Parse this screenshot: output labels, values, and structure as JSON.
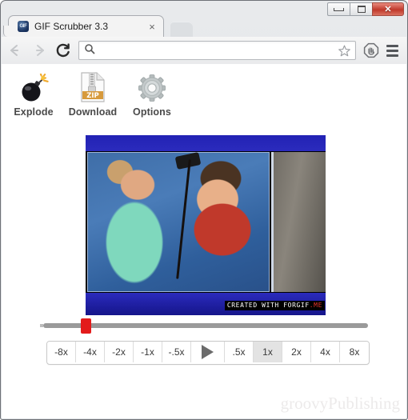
{
  "window": {
    "controls": [
      {
        "name": "minimize",
        "label": "–"
      },
      {
        "name": "maximize",
        "label": "□"
      },
      {
        "name": "close",
        "label": "✕"
      }
    ]
  },
  "tab": {
    "title": "GIF Scrubber 3.3",
    "favicon_label": "GIF",
    "close_label": "×"
  },
  "browser": {
    "back_label": "←",
    "forward_label": "→",
    "reload_label": "↻",
    "omnibox_value": "",
    "omnibox_placeholder": "",
    "search_icon": "search-icon",
    "star_icon": "star-icon",
    "extension_icon": "adblock-stop-hand-icon",
    "menu_icon": "hamburger-menu-icon"
  },
  "app": {
    "tools": [
      {
        "label": "Explode",
        "icon": "bomb-icon"
      },
      {
        "label": "Download",
        "icon": "zip-file-icon"
      },
      {
        "label": "Options",
        "icon": "gear-icon"
      }
    ],
    "gif": {
      "watermark_text": "CREATED WITH FORGIF",
      "watermark_suffix": ".ME",
      "alt": "News clip: woman using hair clippers on a boy's head"
    },
    "scrubber": {
      "position_percent": 12,
      "min": 0,
      "max": 100
    },
    "speeds": [
      {
        "label": "-8x",
        "active": false
      },
      {
        "label": "-4x",
        "active": false
      },
      {
        "label": "-2x",
        "active": false
      },
      {
        "label": "-1x",
        "active": false
      },
      {
        "label": "-.5x",
        "active": false
      },
      {
        "label": "play",
        "active": false,
        "is_play": true
      },
      {
        "label": ".5x",
        "active": false
      },
      {
        "label": "1x",
        "active": true
      },
      {
        "label": "2x",
        "active": false
      },
      {
        "label": "4x",
        "active": false
      },
      {
        "label": "8x",
        "active": false
      }
    ]
  },
  "brand": {
    "watermark": "groovyPublishing"
  },
  "colors": {
    "accent_red": "#e31b1b",
    "active_button_bg": "#e3e3e3",
    "close_button": "#c0392b",
    "gif_blue": "#2222b4"
  }
}
